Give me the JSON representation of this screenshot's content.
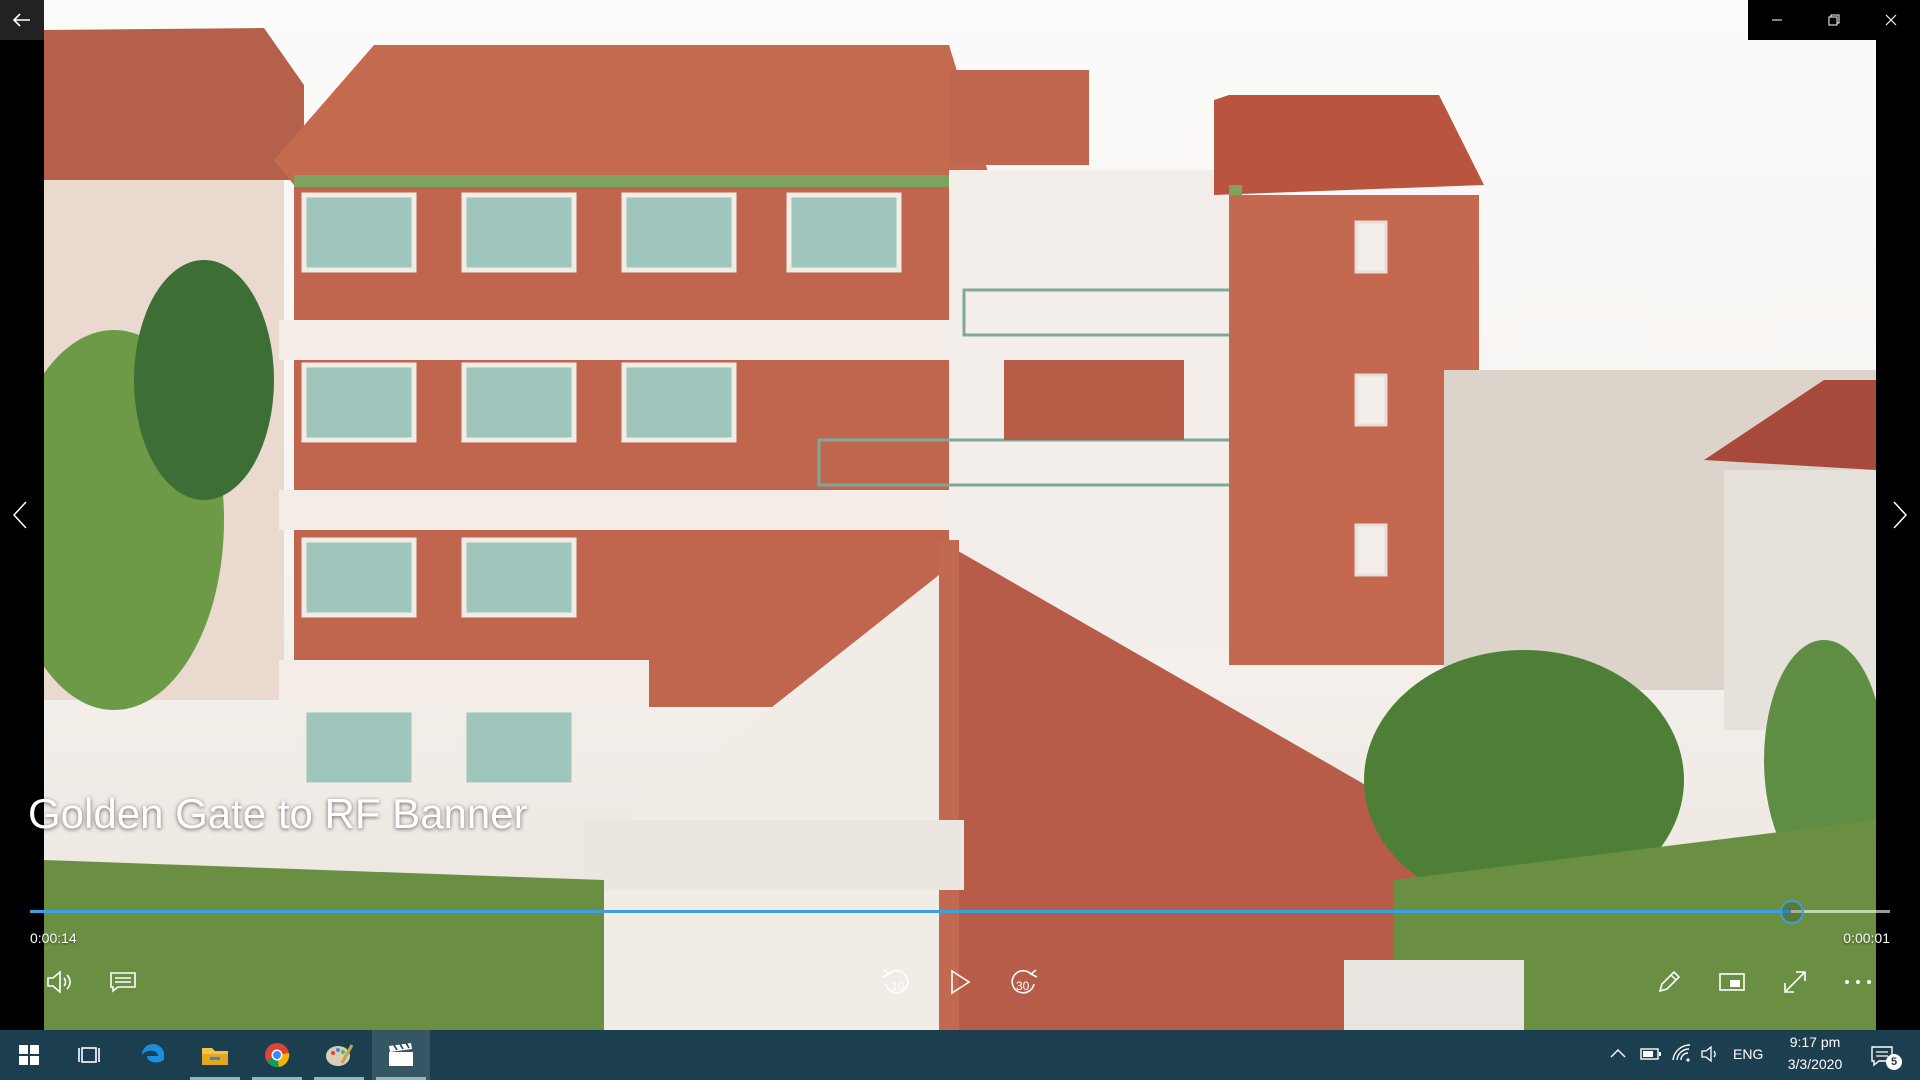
{
  "window": {
    "back_icon": "arrow-left-icon",
    "minimize_icon": "minimize-icon",
    "restore_icon": "restore-icon",
    "close_icon": "close-icon"
  },
  "video": {
    "title": "Golden Gate to RF Banner",
    "elapsed": "0:00:14",
    "remaining": "0:00:01",
    "progress": 0.947
  },
  "controls": {
    "left": [
      "volume-icon",
      "captions-icon"
    ],
    "center": [
      {
        "icon": "skip-back-icon",
        "label": "10"
      },
      {
        "icon": "play-icon",
        "label": ""
      },
      {
        "icon": "skip-forward-icon",
        "label": "30"
      }
    ],
    "right": [
      "edit-pencil-icon",
      "mini-view-icon",
      "fullscreen-icon",
      "more-icon"
    ]
  },
  "taskbar": {
    "apps": [
      "start-icon",
      "task-view-icon",
      "edge-icon",
      "file-explorer-icon",
      "chrome-icon",
      "paint-icon",
      "movies-tv-icon"
    ],
    "language": "ENG",
    "time": "9:17 pm",
    "date": "3/3/2020",
    "notification_count": "5"
  },
  "colors": {
    "accent": "#3aa0e0",
    "taskbar": "#1c3f4f"
  }
}
